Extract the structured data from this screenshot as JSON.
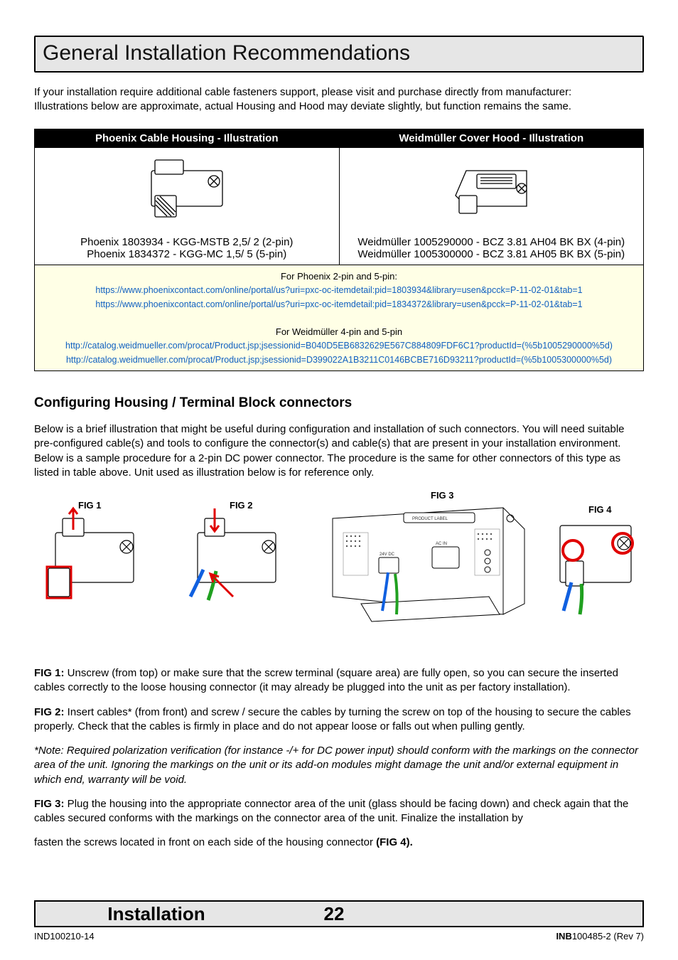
{
  "title": "General Installation Recommendations",
  "intro": {
    "line1": "If your installation require additional cable fasteners support, please visit and purchase directly from manufacturer:",
    "line2": "Illustrations below are approximate, actual Housing and Hood may deviate slightly, but function remains the same."
  },
  "table": {
    "header_left": "Phoenix Cable Housing - Illustration",
    "header_right": "Weidmüller Cover Hood - Illustration",
    "left_caption_1": "Phoenix 1803934 - KGG-MSTB 2,5/ 2 (2-pin)",
    "left_caption_2": "Phoenix 1834372 - KGG-MC 1,5/ 5 (5-pin)",
    "right_caption_1": "Weidmüller 1005290000 - BCZ 3.81 AH04 BK BX (4-pin)",
    "right_caption_2": "Weidmüller 1005300000 - BCZ 3.81 AH05 BK BX (5-pin)",
    "link_label_1": "For Phoenix 2-pin and 5-pin:",
    "link_p1": "https://www.phoenixcontact.com/online/portal/us?uri=pxc-oc-itemdetail:pid=1803934&library=usen&pcck=P-11-02-01&tab=1",
    "link_p2": "https://www.phoenixcontact.com/online/portal/us?uri=pxc-oc-itemdetail:pid=1834372&library=usen&pcck=P-11-02-01&tab=1",
    "link_label_2": "For Weidmüller 4-pin and 5-pin",
    "link_w1": "http://catalog.weidmueller.com/procat/Product.jsp;jsessionid=B040D5EB6832629E567C884809FDF6C1?productId=(%5b1005290000%5d)",
    "link_w2": "http://catalog.weidmueller.com/procat/Product.jsp;jsessionid=D399022A1B3211C0146BCBE716D93211?productId=(%5b1005300000%5d)"
  },
  "section": {
    "heading": "Configuring Housing / Terminal Block connectors",
    "intro": "Below is a brief illustration that might be useful during configuration and installation of such connectors. You will need suitable pre-configured cable(s) and tools to configure the connector(s) and cable(s) that are present in your installation environment. Below is a sample procedure for a 2-pin DC power connector. The procedure is the same for other connectors of this type as listed in table above. Unit used as illustration below is for reference only."
  },
  "figs": {
    "fig1_label": "FIG 1",
    "fig2_label": "FIG 2",
    "fig3_label": "FIG 3",
    "fig4_label": "FIG 4",
    "fig3_small_text": "PRODUCT LABEL",
    "fig3_24v": "24V DC",
    "fig3_acin": "AC IN"
  },
  "descriptions": {
    "f1_bold": "FIG 1:",
    "f1_text": " Unscrew (from top) or make sure that the screw terminal (square area) are fully open, so you can secure the inserted cables correctly to the loose housing connector (it may already be plugged into the unit as per factory installation).",
    "f2_bold": "FIG 2:",
    "f2_text": " Insert cables* (from front) and screw / secure the cables by turning the screw on top of the housing to secure the cables properly. Check that the cables is firmly in place and do not appear loose or falls out when pulling gently.",
    "note": "*Note: Required polarization verification (for instance -/+ for DC power input) should conform with the markings on the connector area of the unit. Ignoring the markings on the unit or its add-on modules might damage the unit and/or external equipment in which end, warranty will be void.",
    "f3_bold": "FIG 3:",
    "f3_text": " Plug the housing into the appropriate connector area of the unit (glass should be facing down) and check again that the cables secured conforms with the markings on the connector area of the unit. Finalize the installation by",
    "f4_text_pre": "fasten the screws located in front on each side of the housing connector ",
    "f4_bold": "(FIG 4)."
  },
  "footer": {
    "section": "Installation",
    "page": "22",
    "doc_left": "IND100210-14",
    "doc_right_bold": "INB",
    "doc_right_rest": "100485-2 (Rev 7)"
  }
}
